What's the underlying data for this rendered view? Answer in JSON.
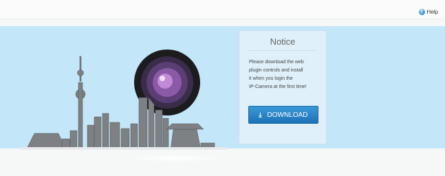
{
  "header": {
    "help_label": "Help",
    "help_icon": "help-circle-icon"
  },
  "notice": {
    "title": "Notice",
    "lines": [
      "Please download the web",
      "plugin controls and install",
      "it when you login the",
      "IP-Camera at the first time!"
    ],
    "download_label": "DOWNLOAD",
    "download_icon": "download-arrow-icon"
  },
  "colors": {
    "banner": "#c4e6f9",
    "button": "#2b86c8"
  }
}
